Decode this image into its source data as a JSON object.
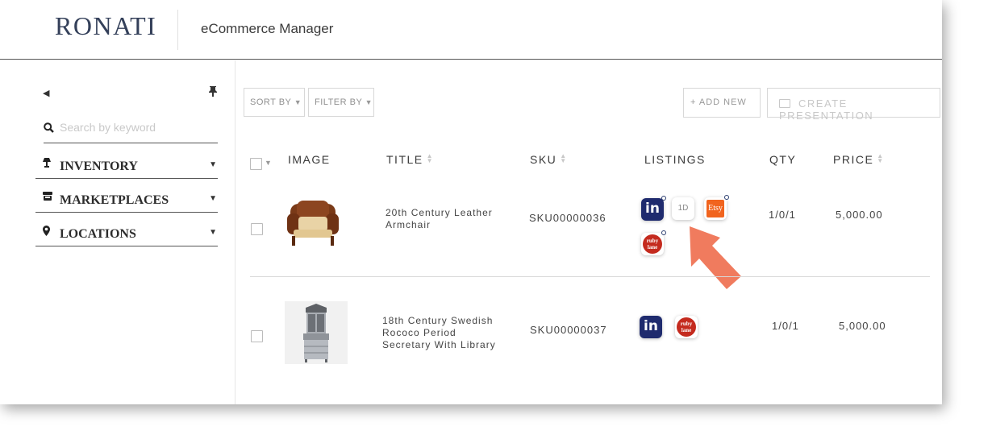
{
  "header": {
    "logo": "RONATI",
    "app_name": "eCommerce Manager"
  },
  "sidebar": {
    "collapse_icon": "triangle-left-icon",
    "pin_icon": "pin-icon",
    "search": {
      "placeholder": "Search by keyword",
      "value": ""
    },
    "items": [
      {
        "label": "INVENTORY",
        "icon": "lamp-icon"
      },
      {
        "label": "MARKETPLACES",
        "icon": "store-icon"
      },
      {
        "label": "LOCATIONS",
        "icon": "map-marker-icon"
      }
    ]
  },
  "toolbar": {
    "sort_label": "SORT BY",
    "filter_label": "FILTER BY",
    "add_new_label": "+ ADD NEW",
    "create_presentation_label": "CREATE PRESENTATION"
  },
  "table": {
    "columns": [
      "IMAGE",
      "TITLE",
      "SKU",
      "LISTINGS",
      "QTY",
      "PRICE"
    ],
    "rows": [
      {
        "title_lines": [
          "20th Century Leather",
          "Armchair"
        ],
        "sku": "SKU00000036",
        "qty": "1/0/1",
        "price": "5,000.00",
        "listings": [
          "1stdibs",
          "1D",
          "Etsy",
          "ruby lane"
        ]
      },
      {
        "title_lines": [
          "18th Century Swedish",
          "Rococo Period",
          "Secretary With Library"
        ],
        "sku": "SKU00000037",
        "qty": "1/0/1",
        "price": "5,000.00",
        "listings": [
          "1stdibs",
          "ruby lane"
        ]
      }
    ]
  },
  "badges": {
    "in": "in",
    "d": "1D",
    "etsy": "Etsy",
    "ruby_top": "ruby",
    "ruby_bottom": "lane"
  },
  "colors": {
    "brand": "#34405a",
    "pointer_arrow": "#f07b5e",
    "in_badge": "#1f2b6e",
    "etsy": "#f1641e",
    "ruby": "#c42a1e"
  }
}
